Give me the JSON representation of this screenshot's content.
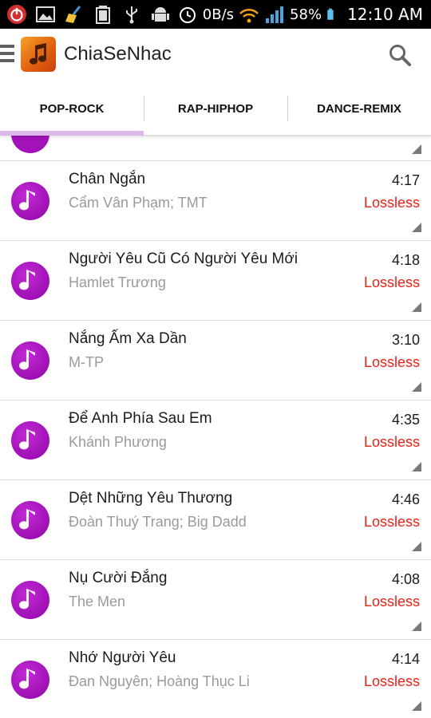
{
  "status_bar": {
    "net_speed": "0B/s",
    "battery": "58%",
    "time": "12:10 AM",
    "icons": [
      "power-icon",
      "image-icon",
      "broom-icon",
      "battery-usb-icon",
      "usb-icon",
      "android-icon",
      "alarm-icon",
      "wifi-icon",
      "signal-icon",
      "battery-icon"
    ]
  },
  "action_bar": {
    "title": "ChiaSeNhac",
    "icons": [
      "drawer-icon",
      "app-logo-icon",
      "search-icon"
    ]
  },
  "tabs": [
    {
      "label": "POP-ROCK",
      "selected": true
    },
    {
      "label": "RAP-HIPHOP",
      "selected": false
    },
    {
      "label": "DANCE-REMIX",
      "selected": false
    }
  ],
  "colors": {
    "accent_purple": "#9e10b4",
    "tab_indicator": "#dcb7ea",
    "lossless_red": "#e8211a"
  },
  "songs": [
    {
      "title": "Chân Ngắn",
      "artist": "Cẩm Vân Phạm; TMT",
      "duration": "4:17",
      "quality": "Lossless"
    },
    {
      "title": "Người Yêu Cũ Có Người Yêu Mới",
      "artist": "Hamlet Trương",
      "duration": "4:18",
      "quality": "Lossless"
    },
    {
      "title": "Nắng Ấm Xa Dần",
      "artist": "M-TP",
      "duration": "3:10",
      "quality": "Lossless"
    },
    {
      "title": "Để Anh Phía Sau Em",
      "artist": "Khánh Phương",
      "duration": "4:35",
      "quality": "Lossless"
    },
    {
      "title": "Dệt Những Yêu Thương",
      "artist": "Đoàn Thuý Trang; Big Dadd",
      "duration": "4:46",
      "quality": "Lossless"
    },
    {
      "title": "Nụ Cười Đắng",
      "artist": "The Men",
      "duration": "4:08",
      "quality": "Lossless"
    },
    {
      "title": "Nhớ Người Yêu",
      "artist": "Đan Nguyên; Hoàng Thục Li",
      "duration": "4:14",
      "quality": "Lossless"
    }
  ]
}
